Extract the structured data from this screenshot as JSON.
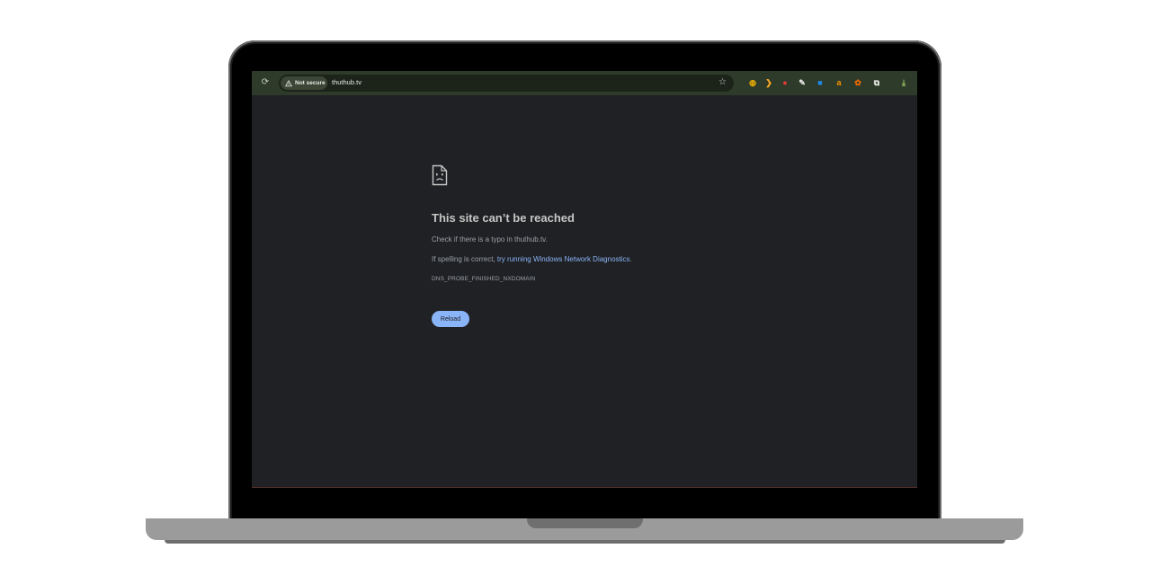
{
  "browser": {
    "reload_glyph": "⟳",
    "security_label": "Not secure",
    "url": "thuthub.tv",
    "bookmark_glyph": "☆",
    "extensions": [
      {
        "name": "ext-icon-1",
        "glyph": "◍",
        "color": "#f4b400"
      },
      {
        "name": "ext-icon-2",
        "glyph": "❯",
        "color": "#f9a825"
      },
      {
        "name": "ext-icon-3",
        "glyph": "●",
        "color": "#e53935"
      },
      {
        "name": "ext-icon-4",
        "glyph": "✎",
        "color": "#e8eae6"
      },
      {
        "name": "ext-icon-5",
        "glyph": "■",
        "color": "#1e88e5"
      },
      {
        "name": "ext-icon-6",
        "glyph": "a",
        "color": "#ff9800"
      },
      {
        "name": "ext-icon-7",
        "glyph": "✿",
        "color": "#ef6c00"
      },
      {
        "name": "extensions-puzzle",
        "glyph": "⧉",
        "color": "#e8eae6"
      },
      {
        "name": "download",
        "glyph": "⤓",
        "color": "#9ccc65"
      }
    ]
  },
  "error_page": {
    "title": "This site can’t be reached",
    "check_text": "Check if there is a typo in thuthub.tv.",
    "spelling_prefix": "If spelling is correct, ",
    "diagnostics_link": "try running Windows Network Diagnostics",
    "spelling_suffix": ".",
    "error_code": "DNS_PROBE_FINISHED_NXDOMAIN",
    "reload_label": "Reload"
  },
  "colors": {
    "toolbar": "#2e3a2a",
    "page_bg": "#202124",
    "link": "#8ab4f8",
    "button": "#8ab4f8"
  }
}
